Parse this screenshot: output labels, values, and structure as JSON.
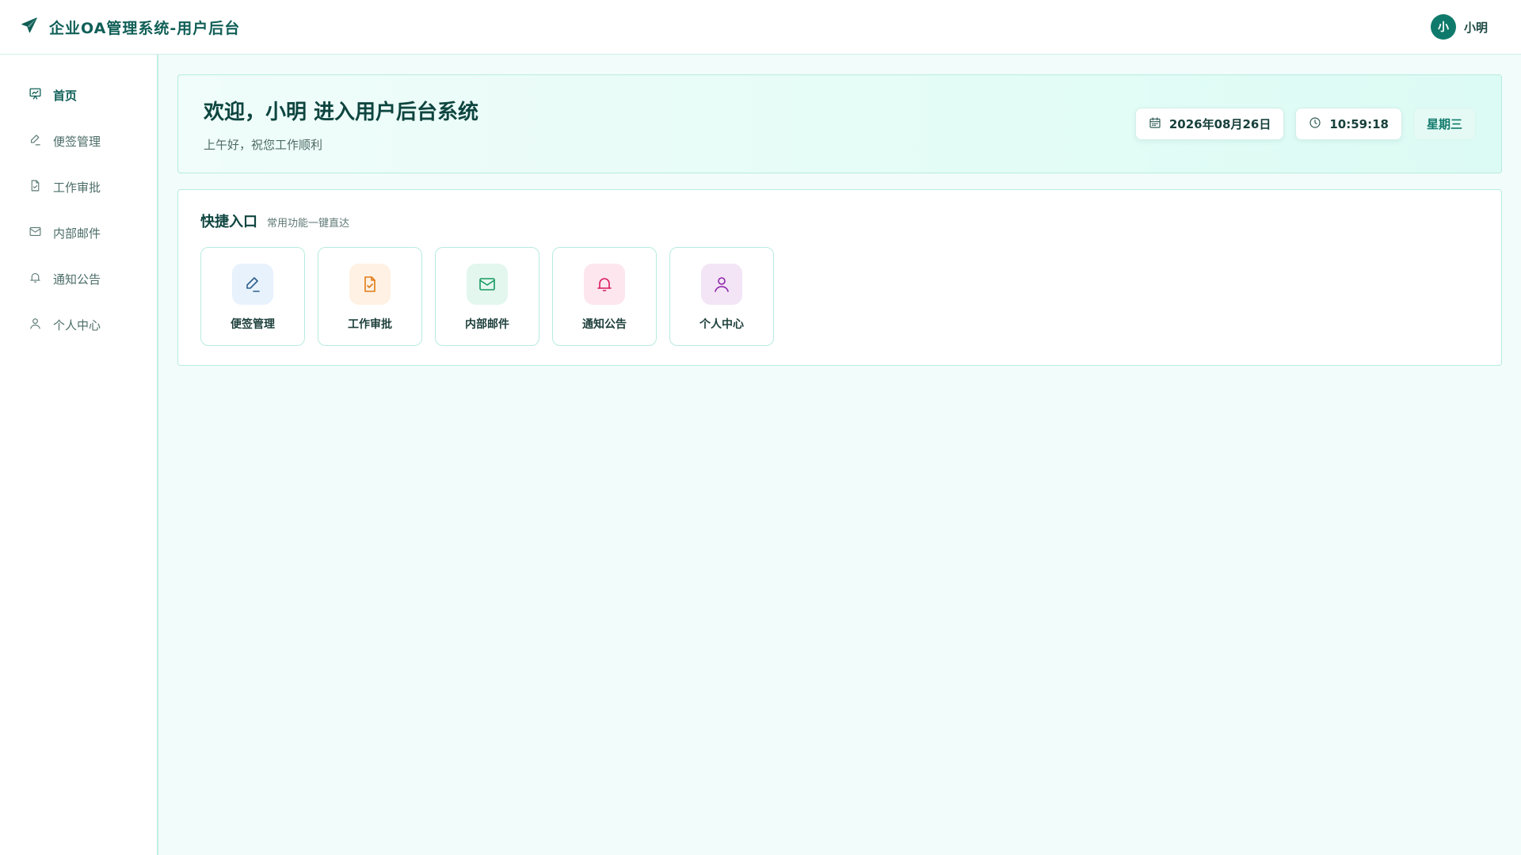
{
  "app": {
    "title": "企业OA管理系统-用户后台"
  },
  "user": {
    "avatar_text": "小",
    "name": "小明"
  },
  "sidebar": {
    "items": [
      {
        "label": "首页",
        "icon": "home-chart-icon",
        "active": true
      },
      {
        "label": "便签管理",
        "icon": "pen-icon",
        "active": false
      },
      {
        "label": "工作审批",
        "icon": "file-check-icon",
        "active": false
      },
      {
        "label": "内部邮件",
        "icon": "mail-icon",
        "active": false
      },
      {
        "label": "通知公告",
        "icon": "bell-icon",
        "active": false
      },
      {
        "label": "个人中心",
        "icon": "user-icon",
        "active": false
      }
    ]
  },
  "welcome": {
    "title": "欢迎，小明 进入用户后台系统",
    "subtitle": "上午好，祝您工作顺利",
    "date": "2026年08月26日",
    "time": "10:59:18",
    "weekday": "星期三"
  },
  "quick": {
    "title": "快捷入口",
    "subtitle": "常用功能一键直达",
    "cards": [
      {
        "label": "便签管理",
        "icon": "pen-icon",
        "color": "#2f5f8a",
        "bg": "#e8f2fd"
      },
      {
        "label": "工作审批",
        "icon": "file-check-icon",
        "color": "#e07b16",
        "bg": "#fff1e3"
      },
      {
        "label": "内部邮件",
        "icon": "mail-icon",
        "color": "#169a62",
        "bg": "#e4f7ee"
      },
      {
        "label": "通知公告",
        "icon": "bell-icon",
        "color": "#d81b60",
        "bg": "#fde6ee"
      },
      {
        "label": "个人中心",
        "icon": "user-icon",
        "color": "#8e24aa",
        "bg": "#f3e5f6"
      }
    ]
  },
  "colors": {
    "brand": "#0f5f57",
    "accent": "#0f7a6b",
    "border": "#b7ece0",
    "background": "#f2fcfa"
  }
}
